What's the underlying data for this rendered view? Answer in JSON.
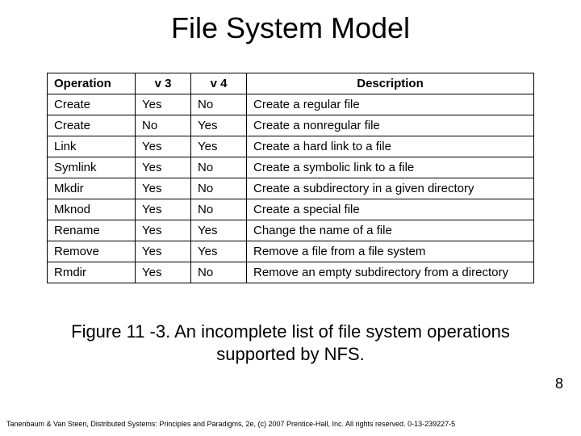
{
  "title": "File System Model",
  "headers": {
    "op": "Operation",
    "v3": "v 3",
    "v4": "v 4",
    "desc": "Description"
  },
  "rows": [
    {
      "op": "Create",
      "v3": "Yes",
      "v4": "No",
      "desc": "Create a regular file"
    },
    {
      "op": "Create",
      "v3": "No",
      "v4": "Yes",
      "desc": "Create a nonregular file"
    },
    {
      "op": "Link",
      "v3": "Yes",
      "v4": "Yes",
      "desc": "Create a hard link to a file"
    },
    {
      "op": "Symlink",
      "v3": "Yes",
      "v4": "No",
      "desc": "Create a symbolic link to a file"
    },
    {
      "op": "Mkdir",
      "v3": "Yes",
      "v4": "No",
      "desc": "Create a subdirectory in a given directory"
    },
    {
      "op": "Mknod",
      "v3": "Yes",
      "v4": "No",
      "desc": "Create a special file"
    },
    {
      "op": "Rename",
      "v3": "Yes",
      "v4": "Yes",
      "desc": "Change the name of a file"
    },
    {
      "op": "Remove",
      "v3": "Yes",
      "v4": "Yes",
      "desc": "Remove a file from a file system"
    },
    {
      "op": "Rmdir",
      "v3": "Yes",
      "v4": "No",
      "desc": "Remove an empty subdirectory from a directory"
    }
  ],
  "caption": "Figure 11 -3. An incomplete list of file system operations supported by NFS.",
  "page_number": "8",
  "citation": "Tanenbaum & Van Steen, Distributed Systems: Principles and Paradigms, 2e, (c) 2007 Prentice-Hall, Inc. All rights reserved. 0-13-239227-5"
}
